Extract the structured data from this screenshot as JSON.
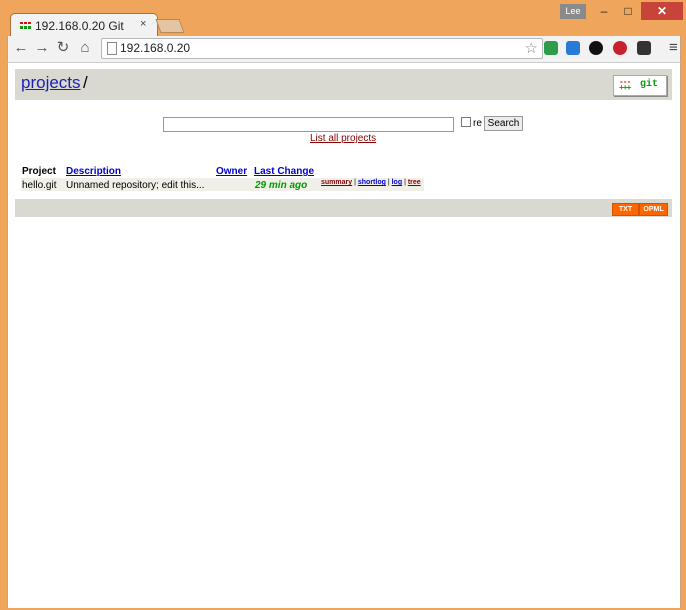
{
  "window": {
    "user_badge": "Lee",
    "minimize": "–",
    "maximize": "□",
    "close": "✕"
  },
  "tab": {
    "title": "192.168.0.20 Git",
    "close": "×"
  },
  "toolbar": {
    "back": "←",
    "forward": "→",
    "reload": "↻",
    "home": "⌂",
    "url": "192.168.0.20",
    "star": "☆",
    "menu": "≡",
    "extension_colors": [
      "#2e9c4a",
      "#2979d6",
      "#111111",
      "#c8232c",
      "#333333"
    ]
  },
  "page": {
    "breadcrumb": "projects",
    "separator": "/",
    "logo": {
      "minus": "---",
      "plus": "+++",
      "word": "git"
    },
    "search": {
      "value": "",
      "re_label": "re",
      "button": "Search"
    },
    "list_all_link": "List all projects",
    "table": {
      "headers": {
        "project": "Project",
        "description": "Description",
        "owner": "Owner",
        "last_change": "Last Change"
      },
      "rows": [
        {
          "project": "hello.git",
          "description": "Unnamed repository; edit this...",
          "owner": "",
          "last_change": "29 min ago",
          "links": {
            "summary": "summary",
            "shortlog": "shortlog",
            "log": "log",
            "tree": "tree",
            "sep": "|"
          }
        }
      ]
    },
    "feeds": {
      "txt": "TXT",
      "opml": "OPML"
    },
    "colors": {
      "link": "#0000cc",
      "visited": "#880000",
      "age": "#009900",
      "bar": "#d9d8d1",
      "feed": "#ff6600"
    }
  }
}
